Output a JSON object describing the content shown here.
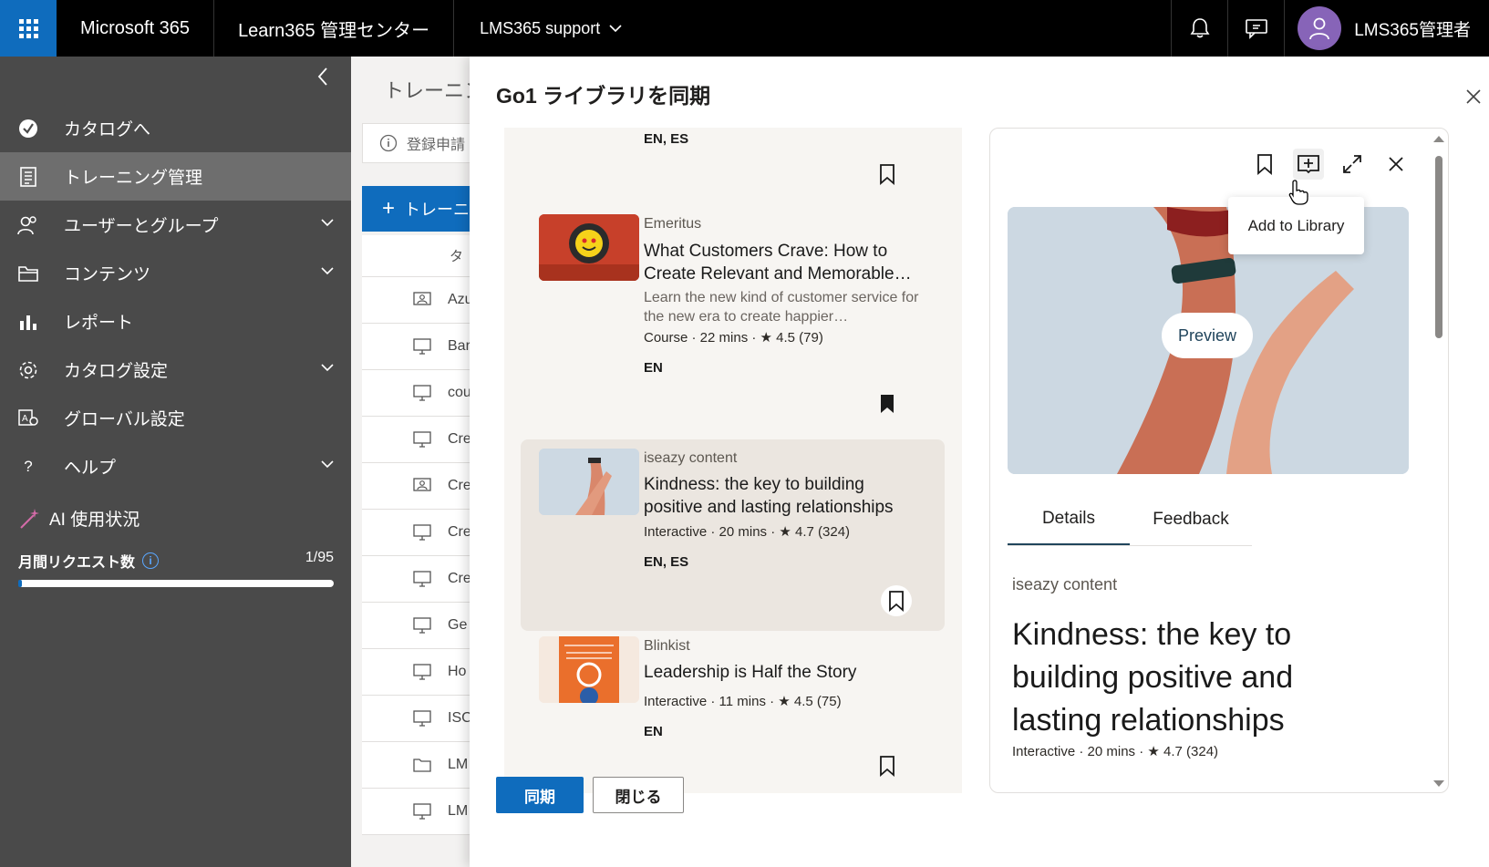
{
  "topbar": {
    "brand": "Microsoft 365",
    "app_name": "Learn365 管理センター",
    "tenant": "LMS365 support",
    "user_name": "LMS365管理者"
  },
  "nav": {
    "items": [
      {
        "label": "カタログへ",
        "icon": "catalog-check-icon"
      },
      {
        "label": "トレーニング管理",
        "icon": "training-doc-icon"
      },
      {
        "label": "ユーザーとグループ",
        "icon": "users-icon"
      },
      {
        "label": "コンテンツ",
        "icon": "folder-icon"
      },
      {
        "label": "レポート",
        "icon": "chart-icon"
      },
      {
        "label": "カタログ設定",
        "icon": "gear-icon"
      },
      {
        "label": "グローバル設定",
        "icon": "global-settings-icon"
      },
      {
        "label": "ヘルプ",
        "icon": "help-icon"
      }
    ],
    "ai_title": "AI 使用状況",
    "ai_label": "月間リクエスト数",
    "ai_value": "1/95",
    "ai_progress": 0.0105
  },
  "background": {
    "title": "トレーニング",
    "banner": "登録申請",
    "add_button": "トレーニ",
    "col_header": "タ",
    "rows": [
      "Azu",
      "Bar",
      "cou",
      "Cre",
      "Cre",
      "Cre",
      "Cre",
      "Ge",
      "Ho",
      "ISC",
      "LM",
      "LM"
    ]
  },
  "dialog": {
    "title": "Go1 ライブラリを同期",
    "sync_button": "同期",
    "close_button": "閉じる"
  },
  "list": {
    "first_langs": "EN, ES",
    "cards": [
      {
        "provider": "Emeritus",
        "title": "What Customers Crave: How to Create Relevant and Memorable…",
        "desc": "Learn the new kind of customer service for the new era to create happier…",
        "meta": "Course · 22 mins · ★ 4.5 (79)",
        "langs": "EN"
      },
      {
        "provider": "iseazy content",
        "title": "Kindness: the key to building positive and lasting relationships",
        "meta": "Interactive · 20 mins · ★ 4.7 (324)",
        "langs": "EN, ES"
      },
      {
        "provider": "Blinkist",
        "title": "Leadership is Half the Story",
        "meta": "Interactive · 11 mins · ★ 4.5 (75)",
        "langs": "EN"
      }
    ]
  },
  "detail": {
    "tooltip": "Add to Library",
    "preview": "Preview",
    "tabs": [
      "Details",
      "Feedback"
    ],
    "provider": "iseazy content",
    "title": "Kindness: the key to building positive and lasting relationships",
    "meta": "Interactive · 20 mins · ★ 4.7 (324)"
  }
}
